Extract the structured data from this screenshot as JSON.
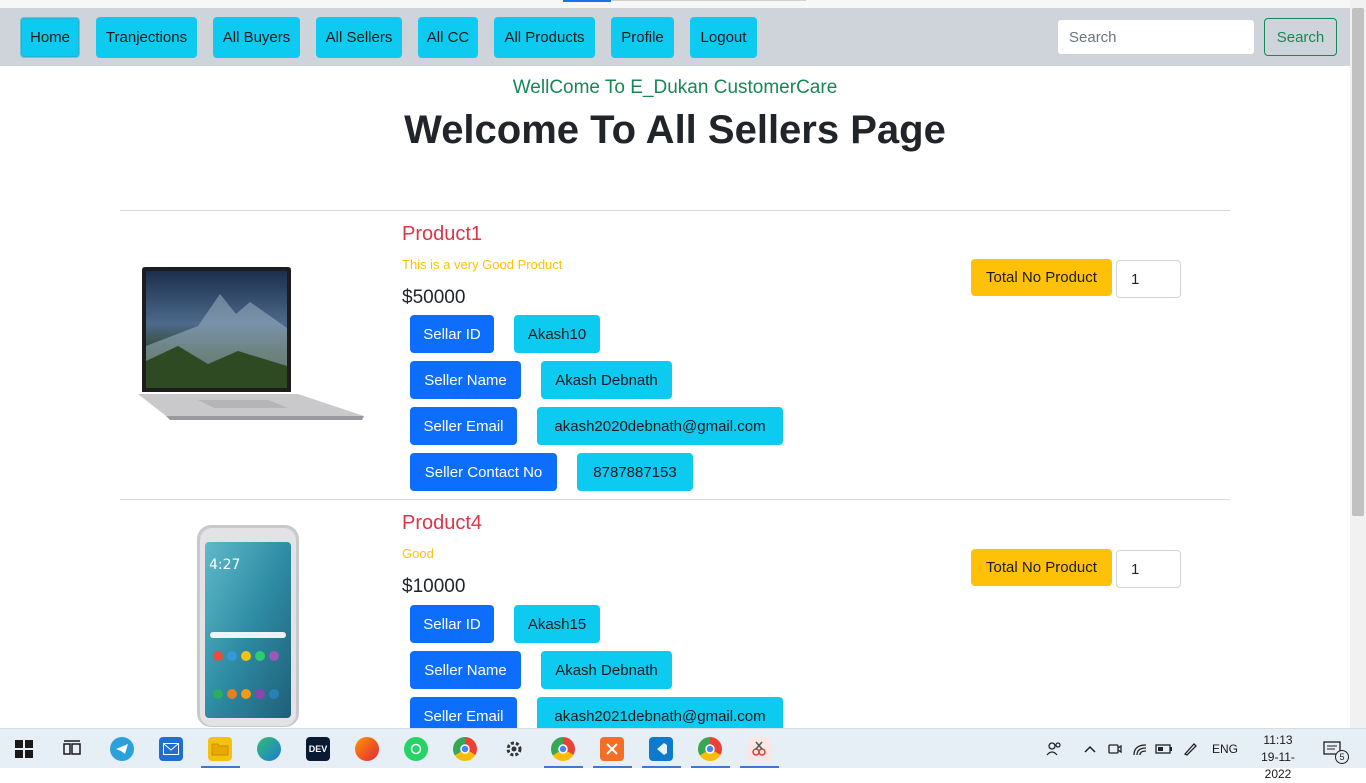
{
  "navbar": {
    "links": [
      "Home",
      "Tranjections",
      "All Buyers",
      "All Sellers",
      "All CC",
      "All Products",
      "Profile",
      "Logout"
    ],
    "search_placeholder": "Search",
    "search_button": "Search"
  },
  "welcome_text": "WellCome To E_Dukan CustomerCare",
  "page_title": "Welcome To All Sellers Page",
  "labels": {
    "seller_id": "Sellar ID",
    "seller_name": "Seller Name",
    "seller_email": "Seller Email",
    "seller_contact": "Seller Contact No",
    "total": "Total No Product"
  },
  "products": [
    {
      "name": "Product1",
      "description": "This is a very Good Product",
      "price": "$50000",
      "seller_id": "Akash10",
      "seller_name": "Akash Debnath",
      "seller_email": "akash2020debnath@gmail.com",
      "seller_contact": "8787887153",
      "quantity": "1",
      "image_icon": "laptop-image"
    },
    {
      "name": "Product4",
      "description": "Good",
      "price": "$10000",
      "seller_id": "Akash15",
      "seller_name": "Akash Debnath",
      "seller_email": "akash2021debnath@gmail.com",
      "quantity": "1",
      "image_icon": "phone-image"
    }
  ],
  "taskbar": {
    "language": "ENG",
    "time": "11:13",
    "date": "19-11-2022",
    "notification_count": "5",
    "dev_label": "DEV"
  }
}
